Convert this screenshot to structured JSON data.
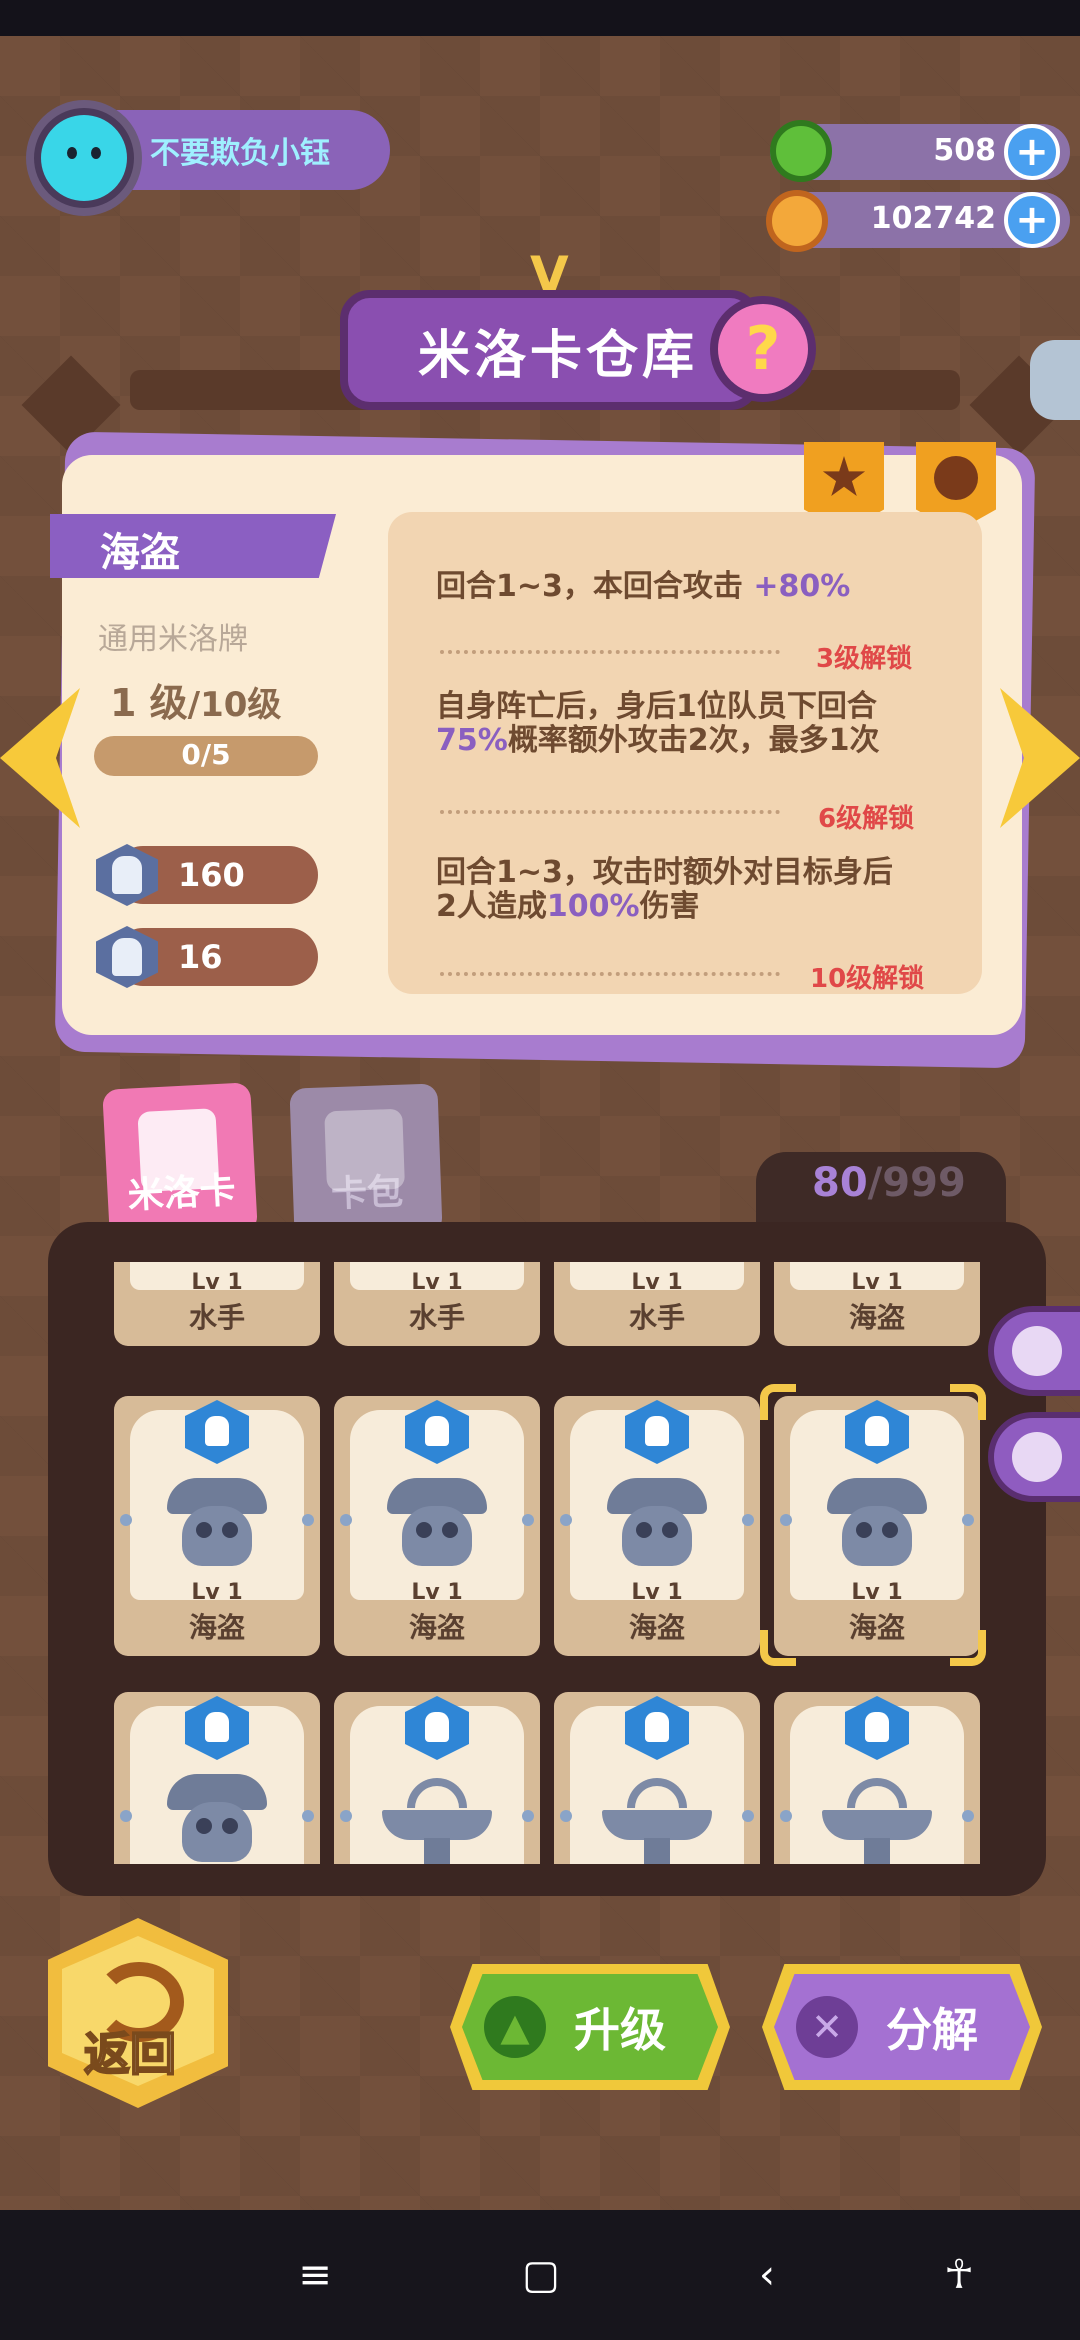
{
  "profile": {
    "username": "不要欺负小钰"
  },
  "currency": [
    {
      "icon": "green-gem-icon",
      "value": "508",
      "plus": "+"
    },
    {
      "icon": "planet-coin-icon",
      "value": "102742",
      "plus": "+"
    }
  ],
  "title": {
    "text": "米洛卡仓库",
    "help": "?",
    "mark": "V"
  },
  "card": {
    "name": "海盗",
    "type": "通用米洛牌",
    "level": "1 级",
    "max_level": "/10级",
    "exp": "0/5",
    "stats": [
      {
        "icon": "attack-icon",
        "value": "160"
      },
      {
        "icon": "defense-icon",
        "value": "16"
      }
    ],
    "skills": [
      {
        "text_a": "回合1~3，本回合攻击 ",
        "highlight": "+80%",
        "text_b": "",
        "unlock": "3级解锁"
      },
      {
        "text_a": "自身阵亡后，身后1位队员下回合",
        "highlight": "75%",
        "text_b": "概率额外攻击2次，最多1次",
        "unlock": "6级解锁"
      },
      {
        "text_a": "回合1~3，攻击时额外对目标身后2人造成",
        "highlight": "100%",
        "text_b": "伤害",
        "unlock": "10级解锁"
      }
    ]
  },
  "tabs": [
    {
      "label": "米洛卡",
      "active": true
    },
    {
      "label": "卡包",
      "active": false
    }
  ],
  "inventory": {
    "count": "80",
    "max": "/999",
    "rows": [
      [
        {
          "lv": "Lv 1",
          "name": "水手"
        },
        {
          "lv": "Lv 1",
          "name": "水手"
        },
        {
          "lv": "Lv 1",
          "name": "水手"
        },
        {
          "lv": "Lv 1",
          "name": "海盗"
        }
      ],
      [
        {
          "lv": "Lv 1",
          "name": "海盗",
          "art": "pirate"
        },
        {
          "lv": "Lv 1",
          "name": "海盗",
          "art": "pirate"
        },
        {
          "lv": "Lv 1",
          "name": "海盗",
          "art": "pirate"
        },
        {
          "lv": "Lv 1",
          "name": "海盗",
          "art": "pirate",
          "selected": true
        }
      ],
      [
        {
          "art": "pirate"
        },
        {
          "art": "fountain"
        },
        {
          "art": "fountain"
        },
        {
          "art": "fountain"
        }
      ]
    ]
  },
  "side_buttons": [
    "filter-icon",
    "sort-icon"
  ],
  "buttons": {
    "back": "返回",
    "upgrade": "升级",
    "decompose": "分解"
  },
  "colors": {
    "accent_purple": "#8b5fc2",
    "highlight_yellow": "#f4c84a",
    "unlock_red": "#e04848"
  }
}
